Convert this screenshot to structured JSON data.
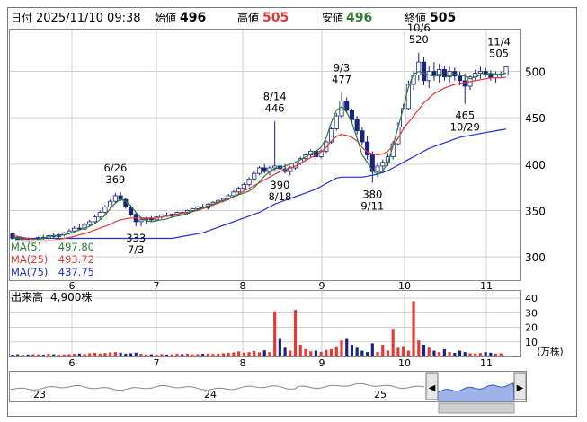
{
  "header": {
    "date_label": "日付",
    "datetime": "2025/11/10 09:38",
    "open_label": "始値",
    "open": "496",
    "high_label": "高値",
    "high": "505",
    "low_label": "安値",
    "low": "496",
    "close_label": "終値",
    "close": "505"
  },
  "colors": {
    "up": "#ffffff",
    "down": "#1a237e",
    "ma5": "#2e7d32",
    "ma25": "#e53935",
    "ma75": "#1e2fd6",
    "vol_up": "#e53935",
    "vol_down": "#1a237e",
    "high_text": "#e53935",
    "low_text": "#2e7d32"
  },
  "chart_data": [
    {
      "type": "candlestick",
      "ylim": [
        275,
        545
      ],
      "yticks": [
        "300",
        "350",
        "400",
        "450",
        "500"
      ],
      "xticks": [
        "6",
        "7",
        "8",
        "9",
        "10",
        "11"
      ],
      "grid": true,
      "moving_averages": [
        {
          "name": "MA(5)",
          "value": "497.80"
        },
        {
          "name": "MA(25)",
          "value": "493.72"
        },
        {
          "name": "MA(75)",
          "value": "437.75"
        }
      ],
      "annotations": [
        {
          "date": "6/26",
          "value": "369"
        },
        {
          "date": "7/3",
          "value": "333"
        },
        {
          "date": "8/14",
          "value": "446"
        },
        {
          "date": "8/18",
          "value": "390"
        },
        {
          "date": "9/3",
          "value": "477"
        },
        {
          "date": "9/11",
          "value": "380"
        },
        {
          "date": "10/6",
          "value": "520"
        },
        {
          "date": "10/29",
          "value": "465"
        },
        {
          "date": "11/4",
          "value": "505"
        }
      ],
      "ma_series": {
        "ma5": [
          321,
          320,
          319,
          318,
          318,
          319,
          320,
          322,
          323,
          323,
          324,
          325,
          327,
          329,
          331,
          333,
          336,
          340,
          345,
          352,
          358,
          362,
          360,
          355,
          348,
          342,
          339,
          338,
          339,
          340,
          341,
          343,
          344,
          345,
          347,
          349,
          351,
          353,
          355,
          357,
          359,
          361,
          363,
          365,
          367,
          369,
          371,
          375,
          381,
          387,
          392,
          395,
          396,
          398,
          400,
          402,
          405,
          408,
          411,
          414,
          418,
          428,
          445,
          458,
          462,
          456,
          445,
          428,
          410,
          402,
          393,
          389,
          393,
          401,
          420,
          440,
          460,
          483,
          497,
          500,
          498,
          496,
          495,
          497,
          496,
          495,
          497,
          496,
          495,
          492,
          494,
          496,
          497,
          498,
          497,
          497,
          498
        ],
        "ma25": [
          324,
          322,
          321,
          320,
          319,
          318,
          318,
          318,
          318,
          319,
          320,
          321,
          322,
          324,
          325,
          327,
          329,
          331,
          333,
          335,
          338,
          340,
          341,
          342,
          342,
          342,
          342,
          342,
          342,
          343,
          344,
          345,
          346,
          347,
          348,
          349,
          350,
          352,
          354,
          356,
          358,
          360,
          362,
          365,
          368,
          371,
          374,
          377,
          380,
          383,
          386,
          389,
          392,
          394,
          396,
          398,
          401,
          404,
          407,
          410,
          413,
          418,
          425,
          430,
          432,
          431,
          429,
          425,
          418,
          413,
          411,
          410,
          411,
          414,
          420,
          428,
          438,
          445,
          452,
          459,
          466,
          471,
          476,
          479,
          482,
          484,
          486,
          487,
          488,
          489,
          490,
          491,
          492,
          493,
          493,
          493,
          493.7
        ],
        "ma75": [
          321,
          321,
          320,
          320,
          320,
          320,
          320,
          320,
          320,
          320,
          320,
          320,
          320,
          320,
          320,
          320,
          320,
          320,
          320,
          320,
          320,
          320,
          320,
          320,
          320,
          320,
          320,
          320,
          320,
          320,
          320,
          320,
          321,
          322,
          323,
          324,
          325,
          326,
          328,
          330,
          332,
          334,
          336,
          338,
          340,
          342,
          344,
          346,
          348,
          351,
          354,
          357,
          359,
          361,
          363,
          365,
          367,
          369,
          371,
          373,
          376,
          379,
          382,
          385,
          386,
          386,
          386,
          386,
          386,
          387,
          388,
          389,
          391,
          393,
          396,
          399,
          402,
          405,
          408,
          411,
          414,
          417,
          419,
          421,
          423,
          425,
          427,
          429,
          430,
          431,
          432,
          433,
          434,
          435,
          436,
          437,
          437.75
        ]
      },
      "candles": [
        [
          325,
          326,
          318,
          320
        ],
        [
          320,
          322,
          316,
          318
        ],
        [
          318,
          320,
          316,
          319
        ],
        [
          319,
          321,
          314,
          316
        ],
        [
          316,
          319,
          315,
          318
        ],
        [
          318,
          322,
          317,
          321
        ],
        [
          321,
          324,
          318,
          320
        ],
        [
          320,
          324,
          319,
          323
        ],
        [
          323,
          326,
          320,
          322
        ],
        [
          322,
          325,
          320,
          324
        ],
        [
          324,
          327,
          322,
          326
        ],
        [
          326,
          330,
          324,
          328
        ],
        [
          328,
          333,
          326,
          331
        ],
        [
          331,
          335,
          329,
          330
        ],
        [
          330,
          337,
          329,
          335
        ],
        [
          335,
          340,
          333,
          338
        ],
        [
          338,
          345,
          336,
          343
        ],
        [
          343,
          350,
          341,
          348
        ],
        [
          348,
          356,
          346,
          354
        ],
        [
          354,
          362,
          352,
          360
        ],
        [
          360,
          369,
          358,
          366
        ],
        [
          366,
          370,
          360,
          362
        ],
        [
          362,
          364,
          352,
          354
        ],
        [
          354,
          356,
          344,
          346
        ],
        [
          346,
          348,
          333,
          338
        ],
        [
          338,
          342,
          333,
          340
        ],
        [
          340,
          343,
          336,
          341
        ],
        [
          341,
          344,
          338,
          340
        ],
        [
          340,
          344,
          339,
          343
        ],
        [
          343,
          346,
          341,
          345
        ],
        [
          345,
          348,
          343,
          344
        ],
        [
          344,
          347,
          342,
          346
        ],
        [
          346,
          349,
          344,
          348
        ],
        [
          348,
          351,
          346,
          347
        ],
        [
          347,
          351,
          345,
          350
        ],
        [
          350,
          353,
          348,
          352
        ],
        [
          352,
          355,
          350,
          354
        ],
        [
          354,
          357,
          352,
          353
        ],
        [
          353,
          358,
          351,
          357
        ],
        [
          357,
          360,
          355,
          359
        ],
        [
          359,
          362,
          357,
          361
        ],
        [
          361,
          364,
          359,
          363
        ],
        [
          363,
          368,
          361,
          366
        ],
        [
          366,
          372,
          364,
          370
        ],
        [
          370,
          376,
          368,
          374
        ],
        [
          374,
          380,
          372,
          378
        ],
        [
          378,
          386,
          376,
          384
        ],
        [
          384,
          392,
          382,
          390
        ],
        [
          390,
          398,
          388,
          396
        ],
        [
          396,
          400,
          390,
          392
        ],
        [
          392,
          398,
          388,
          396
        ],
        [
          396,
          446,
          393,
          398
        ],
        [
          398,
          402,
          392,
          395
        ],
        [
          395,
          400,
          390,
          392
        ],
        [
          392,
          398,
          388,
          396
        ],
        [
          396,
          403,
          394,
          401
        ],
        [
          401,
          408,
          399,
          406
        ],
        [
          406,
          412,
          403,
          410
        ],
        [
          410,
          416,
          407,
          414
        ],
        [
          414,
          418,
          405,
          408
        ],
        [
          408,
          416,
          406,
          414
        ],
        [
          414,
          426,
          412,
          424
        ],
        [
          424,
          440,
          422,
          438
        ],
        [
          438,
          455,
          436,
          452
        ],
        [
          452,
          477,
          450,
          468
        ],
        [
          468,
          472,
          455,
          458
        ],
        [
          458,
          460,
          445,
          448
        ],
        [
          448,
          452,
          432,
          436
        ],
        [
          436,
          440,
          420,
          424
        ],
        [
          424,
          430,
          405,
          410
        ],
        [
          410,
          414,
          380,
          392
        ],
        [
          392,
          402,
          386,
          398
        ],
        [
          398,
          405,
          390,
          402
        ],
        [
          402,
          412,
          398,
          408
        ],
        [
          408,
          425,
          405,
          422
        ],
        [
          422,
          445,
          420,
          440
        ],
        [
          440,
          465,
          438,
          460
        ],
        [
          460,
          490,
          458,
          486
        ],
        [
          486,
          500,
          480,
          496
        ],
        [
          496,
          520,
          490,
          510
        ],
        [
          510,
          515,
          485,
          490
        ],
        [
          490,
          505,
          482,
          500
        ],
        [
          500,
          510,
          490,
          495
        ],
        [
          495,
          508,
          488,
          502
        ],
        [
          502,
          506,
          490,
          494
        ],
        [
          494,
          505,
          488,
          500
        ],
        [
          500,
          504,
          490,
          495
        ],
        [
          495,
          500,
          485,
          490
        ],
        [
          490,
          498,
          465,
          484
        ],
        [
          484,
          496,
          480,
          494
        ],
        [
          494,
          502,
          490,
          498
        ],
        [
          498,
          505,
          492,
          500
        ],
        [
          500,
          504,
          494,
          497
        ],
        [
          497,
          501,
          490,
          493
        ],
        [
          493,
          500,
          488,
          496
        ],
        [
          496,
          500,
          493,
          497
        ],
        [
          496,
          505,
          496,
          505
        ]
      ]
    },
    {
      "type": "bar",
      "title": "出来高",
      "value_label": "4,900株",
      "unit": "(万株)",
      "ylim": [
        0,
        45
      ],
      "yticks": [
        "10",
        "20",
        "30",
        "40"
      ],
      "xticks": [
        "6",
        "7",
        "8",
        "9",
        "10",
        "11"
      ],
      "values": [
        1.2,
        1.5,
        1.0,
        1.3,
        1.6,
        1.4,
        1.2,
        1.8,
        1.5,
        1.2,
        1.4,
        1.6,
        1.8,
        2.0,
        1.7,
        2.2,
        2.5,
        2.0,
        2.4,
        2.8,
        3.0,
        2.6,
        1.9,
        2.2,
        2.6,
        1.8,
        1.4,
        1.5,
        1.2,
        1.6,
        1.3,
        1.5,
        1.8,
        1.6,
        1.9,
        1.4,
        1.6,
        1.8,
        2.0,
        1.7,
        1.9,
        2.2,
        2.5,
        2.8,
        3.5,
        2.6,
        3.0,
        3.8,
        2.8,
        4.2,
        3.0,
        31,
        12,
        6,
        4,
        32,
        8,
        5,
        3.5,
        4.0,
        3.2,
        4.5,
        5,
        7,
        11,
        12,
        8,
        6,
        4,
        3,
        9,
        3,
        8,
        4,
        19,
        6,
        7,
        4,
        38,
        11,
        8,
        6,
        4,
        3,
        5,
        3,
        2.5,
        4,
        3,
        2.2,
        2.0,
        2.4,
        3.0,
        2.6,
        2.0,
        2.2,
        0.5
      ],
      "up_down": [
        0,
        0,
        1,
        0,
        1,
        1,
        0,
        1,
        0,
        1,
        1,
        1,
        1,
        0,
        1,
        1,
        1,
        1,
        1,
        1,
        1,
        0,
        0,
        0,
        0,
        1,
        1,
        0,
        1,
        1,
        0,
        1,
        1,
        0,
        1,
        1,
        1,
        0,
        1,
        1,
        1,
        1,
        1,
        1,
        1,
        1,
        1,
        1,
        1,
        0,
        1,
        1,
        0,
        0,
        1,
        1,
        1,
        1,
        1,
        0,
        1,
        1,
        1,
        1,
        1,
        0,
        0,
        0,
        0,
        0,
        0,
        1,
        1,
        1,
        1,
        1,
        1,
        1,
        1,
        1,
        0,
        1,
        0,
        1,
        0,
        1,
        0,
        0,
        0,
        1,
        1,
        1,
        0,
        0,
        1,
        1,
        1
      ]
    }
  ],
  "overview": {
    "labels": [
      "23",
      "24",
      "25"
    ],
    "scroll_left_arrow": "◀",
    "scroll_right_arrow": "▶"
  }
}
